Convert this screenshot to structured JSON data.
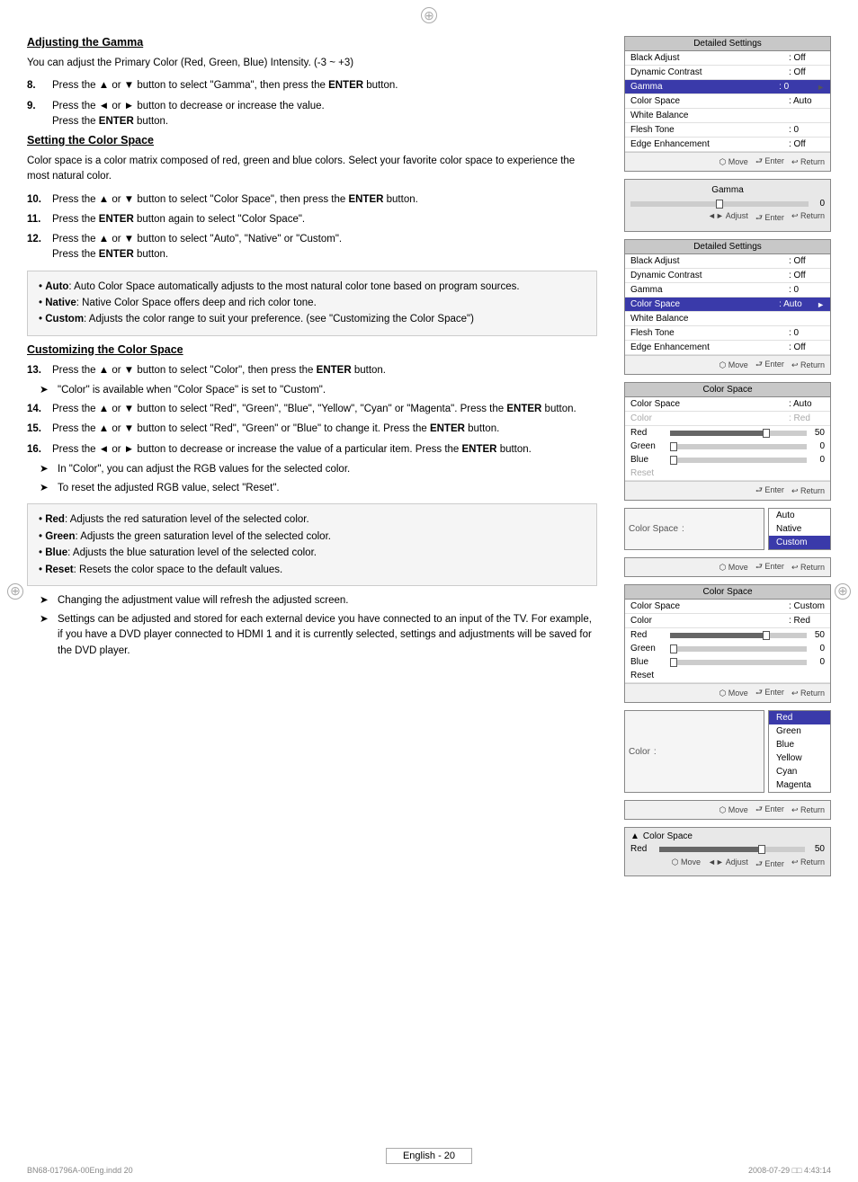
{
  "decorative": {
    "top_symbol": "⊕",
    "side_symbol": "⊕"
  },
  "section1": {
    "heading": "Adjusting the Gamma",
    "intro": "You can adjust the Primary Color (Red, Green, Blue) Intensity. (-3 ~ +3)",
    "steps": [
      {
        "num": "8.",
        "text": "Press the ▲ or ▼ button to select \"Gamma\", then press the ",
        "bold": "ENTER",
        "after": " button."
      },
      {
        "num": "9.",
        "text": "Press the ◄ or ► button to decrease or increase the value.\n            Press the ",
        "bold": "ENTER",
        "after": " button."
      }
    ]
  },
  "section2": {
    "heading": "Setting the Color Space",
    "intro": "Color space is a color matrix composed of red, green and blue colors. Select your favorite color space to experience the most natural color.",
    "steps": [
      {
        "num": "10.",
        "text": "Press the ▲ or ▼ button to select \"Color Space\", then press the ",
        "bold": "ENTER",
        "after": " button."
      },
      {
        "num": "11.",
        "text": "Press the ",
        "bold": "ENTER",
        "after": " button again to select \"Color Space\"."
      },
      {
        "num": "12.",
        "text": "Press the ▲ or ▼ button to select \"Auto\", \"Native\" or \"Custom\".\n            Press the ",
        "bold": "ENTER",
        "after": " button."
      }
    ],
    "infobox": [
      "• Auto: Auto Color Space automatically adjusts to the most natural color tone based on program sources.",
      "• Native: Native Color Space offers deep and rich color tone.",
      "• Custom: Adjusts the color range to suit your preference. (see \"Customizing the Color Space\")"
    ]
  },
  "section3": {
    "heading": "Customizing the Color Space",
    "steps": [
      {
        "num": "13.",
        "text": "Press the ▲ or ▼ button to select \"Color\", then press the ",
        "bold": "ENTER",
        "after": " button."
      },
      {
        "num_arrow": "➤",
        "text": "\"Color\" is available when \"Color Space\" is set to \"Custom\"."
      },
      {
        "num": "14.",
        "text": "Press the ▲ or ▼ button to select \"Red\", \"Green\", \"Blue\", \"Yellow\", \"Cyan\" or \"Magenta\". Press the ",
        "bold": "ENTER",
        "after": " button."
      },
      {
        "num": "15.",
        "text": "Press the ▲ or ▼ button to select \"Red\", \"Green\" or \"Blue\" to change it. Press the ",
        "bold": "ENTER",
        "after": " button."
      },
      {
        "num": "16.",
        "text": "Press the ◄ or ► button to decrease or increase the value of a particular item. Press the ",
        "bold": "ENTER",
        "after": " button."
      }
    ],
    "arrows": [
      "In \"Color\", you can adjust the RGB values for the selected color.",
      "To reset the adjusted RGB value, select \"Reset\"."
    ],
    "infobox2": [
      "• Red: Adjusts the red saturation level of the selected color.",
      "• Green: Adjusts the green saturation level of the selected color.",
      "• Blue: Adjusts the blue saturation level of the selected color.",
      "• Reset: Resets the color space to the default values."
    ],
    "arrows2": [
      "Changing the adjustment value will refresh the adjusted screen.",
      "Settings can be adjusted and stored for each external device you have connected to an input of the TV. For example, if you have a DVD player connected to HDMI 1 and it is currently selected, settings and adjustments will be saved for the DVD player."
    ]
  },
  "panels": {
    "detailed_settings_title": "Detailed Settings",
    "rows_gamma": [
      {
        "label": "Black Adjust",
        "value": ": Off",
        "highlighted": false
      },
      {
        "label": "Dynamic Contrast",
        "value": ": Off",
        "highlighted": false
      },
      {
        "label": "Gamma",
        "value": ": 0",
        "highlighted": true,
        "arrow": "►"
      },
      {
        "label": "Color Space",
        "value": ": Auto",
        "highlighted": false
      },
      {
        "label": "White Balance",
        "value": "",
        "highlighted": false
      },
      {
        "label": "Flesh Tone",
        "value": ": 0",
        "highlighted": false
      },
      {
        "label": "Edge Enhancement",
        "value": ": Off",
        "highlighted": false
      }
    ],
    "footer_move": "⬡ Move",
    "footer_enter": "⮐ Enter",
    "footer_return": "↩ Return",
    "gamma_label": "Gamma",
    "gamma_value": "0",
    "gamma_adjust": "◄► Adjust",
    "rows_colorspace": [
      {
        "label": "Black Adjust",
        "value": ": Off",
        "highlighted": false
      },
      {
        "label": "Dynamic Contrast",
        "value": ": Off",
        "highlighted": false
      },
      {
        "label": "Gamma",
        "value": ": 0",
        "highlighted": false
      },
      {
        "label": "Color Space",
        "value": ": Auto",
        "highlighted": true,
        "arrow": "►"
      },
      {
        "label": "White Balance",
        "value": "",
        "highlighted": false
      },
      {
        "label": "Flesh Tone",
        "value": ": 0",
        "highlighted": false
      },
      {
        "label": "Edge Enhancement",
        "value": ": Off",
        "highlighted": false
      }
    ],
    "colorspace_panel_title": "Color Space",
    "colorspace_rows_auto": [
      {
        "label": "Color Space",
        "value": ": Auto",
        "highlighted": false
      },
      {
        "label": "Color",
        "value": ": Red",
        "highlighted": false,
        "dim": true
      },
      {
        "label": "Red",
        "slider": true,
        "val": 50,
        "highlighted": false
      },
      {
        "label": "Green",
        "slider": true,
        "val": 0,
        "highlighted": false
      },
      {
        "label": "Blue",
        "slider": true,
        "val": 0,
        "highlighted": false
      },
      {
        "label": "Reset",
        "value": "",
        "highlighted": false,
        "dim": true
      }
    ],
    "cs_select_options": [
      "Auto",
      "Native",
      "Custom"
    ],
    "cs_selected": "Custom",
    "colorspace_custom_title": "Color Space",
    "colorspace_rows_custom": [
      {
        "label": "Color Space",
        "value": ": Custom",
        "highlighted": false
      },
      {
        "label": "Color",
        "value": ": Red",
        "highlighted": false
      },
      {
        "label": "Red",
        "slider": true,
        "val": 50,
        "highlighted": false
      },
      {
        "label": "Green",
        "slider": true,
        "val": 0,
        "highlighted": false
      },
      {
        "label": "Blue",
        "slider": true,
        "val": 0,
        "highlighted": false
      },
      {
        "label": "Reset",
        "value": "",
        "highlighted": false
      }
    ],
    "color_options": [
      "Red",
      "Green",
      "Blue",
      "Yellow",
      "Cyan",
      "Magenta"
    ],
    "color_selected": "Red",
    "color_panel_label": "Color",
    "bottom_cs_title": "Color Space",
    "bottom_cs_label": "Red",
    "bottom_cs_val": "50"
  },
  "footer": {
    "label": "English - 20",
    "doc_left": "BN68-01796A-00Eng.indd  20",
    "doc_right": "2008-07-29   □□ 4:43:14"
  }
}
